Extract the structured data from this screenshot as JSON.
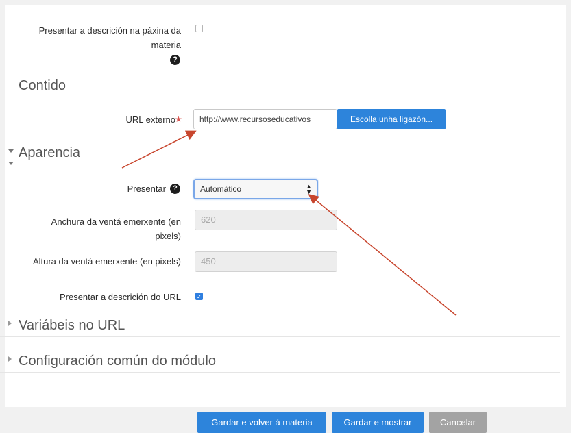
{
  "general": {
    "show_description_label_line1": "Presentar a descrición na páxina da",
    "show_description_label_line2": "materia",
    "help_glyph": "?"
  },
  "sections": {
    "content": "Contido",
    "appearance": "Aparencia",
    "url_variables": "Variábeis no URL",
    "common_settings": "Configuración común do módulo"
  },
  "content": {
    "external_url_label": "URL externo",
    "required_mark": "★",
    "external_url_value": "http://www.recursoseducativos",
    "choose_link_button": "Escolla unha ligazón..."
  },
  "appearance": {
    "display_label": "Presentar",
    "display_value": "Automático",
    "popup_width_label_line1": "Anchura da ventá emerxente (en",
    "popup_width_label_line2": "pixels)",
    "popup_width_value": "620",
    "popup_height_label": "Altura da ventá emerxente (en pixels)",
    "popup_height_value": "450",
    "show_url_description_label": "Presentar a descrición do URL",
    "show_url_description_checked": true
  },
  "footer": {
    "save_return_button": "Gardar e volver á materia",
    "save_display_button": "Gardar e mostrar",
    "cancel_button": "Cancelar"
  },
  "colors": {
    "primary_button": "#2d84db",
    "cancel_button": "#a3a3a3",
    "annotation_arrow": "#c8462e",
    "required_star": "#d9534f"
  }
}
